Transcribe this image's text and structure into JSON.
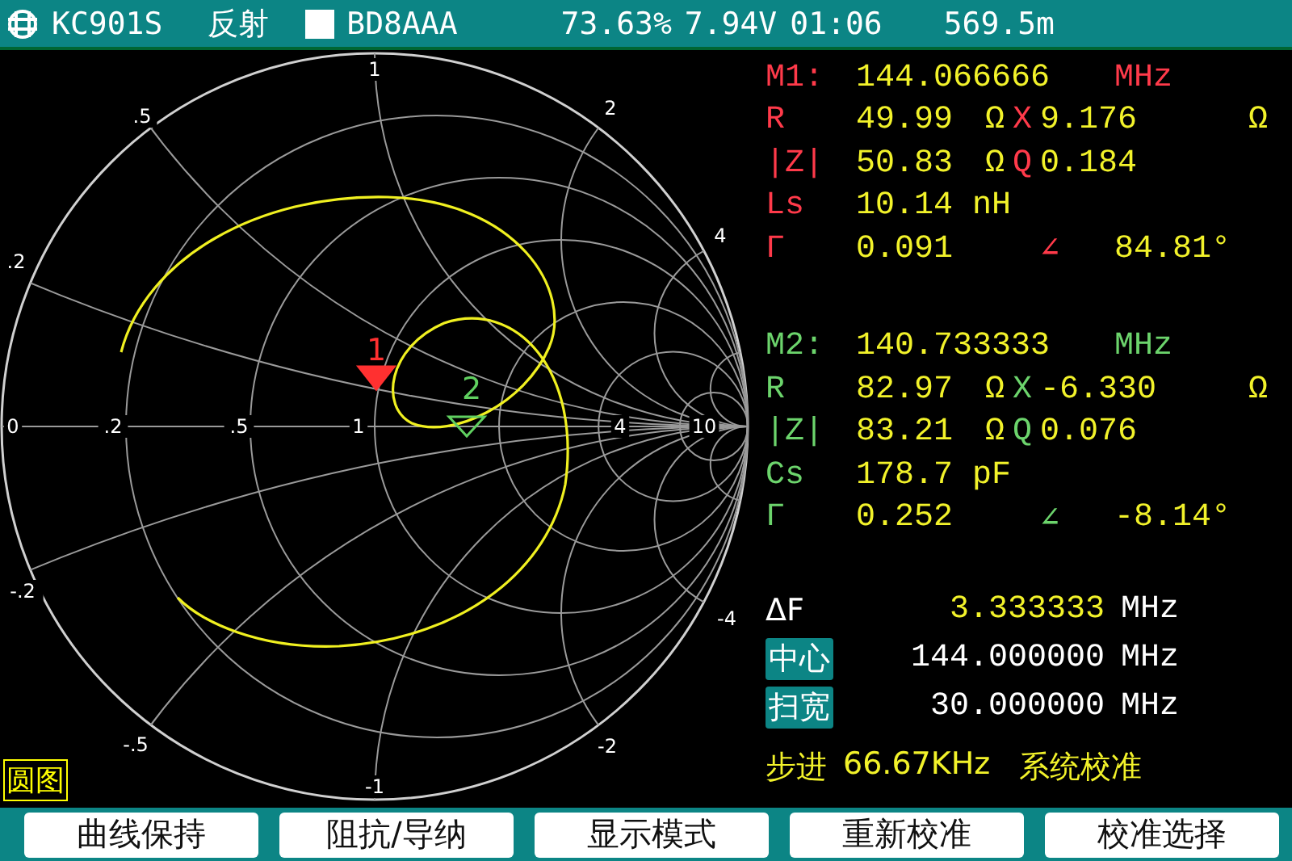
{
  "status_bar": {
    "model": "KC901S",
    "mode": "反射",
    "callsign": "BD8AAA",
    "battery": "73.63%",
    "voltage": "7.94V",
    "time": "01:06",
    "distance": "569.5m"
  },
  "smith_chart": {
    "resistance_labels": [
      "0",
      ".2",
      ".5",
      "1",
      "4",
      "10"
    ],
    "reactance_upper_labels": [
      ".2",
      ".5",
      "1",
      "2",
      "4"
    ],
    "reactance_lower_labels": [
      "-.2",
      "-.5",
      "-1",
      "-2",
      "-4"
    ],
    "markers": [
      {
        "label": "1",
        "color": "#ff3030",
        "filled": true
      },
      {
        "label": "2",
        "color": "#60d060",
        "filled": false
      }
    ],
    "view_label": "圆图"
  },
  "readouts": [
    {
      "title": "M1:",
      "color": "#ff3a4a",
      "freq": "144.066666",
      "unit": "MHz",
      "rows": [
        {
          "kind": "pair",
          "cells": [
            "R",
            "49.99",
            "Ω",
            "X",
            "9.176",
            "Ω"
          ]
        },
        {
          "kind": "pair",
          "cells": [
            "|Z|",
            "50.83",
            "Ω",
            "Q",
            "0.184"
          ]
        },
        {
          "kind": "single",
          "cells": [
            "Ls",
            "10.14 nH"
          ]
        },
        {
          "kind": "polar",
          "cells": [
            "Γ",
            "0.091",
            "",
            "",
            "∠",
            "84.81°"
          ]
        }
      ]
    },
    {
      "title": "M2:",
      "color": "#6cd46c",
      "freq": "140.733333",
      "unit": "MHz",
      "rows": [
        {
          "kind": "pair",
          "cells": [
            "R",
            "82.97",
            "Ω",
            "X",
            "-6.330",
            "Ω"
          ]
        },
        {
          "kind": "pair",
          "cells": [
            "|Z|",
            "83.21",
            "Ω",
            "Q",
            "0.076"
          ]
        },
        {
          "kind": "single",
          "cells": [
            "Cs",
            "178.7 pF"
          ]
        },
        {
          "kind": "polar",
          "cells": [
            "Γ",
            "0.252",
            "",
            "",
            "∠",
            "-8.14°"
          ]
        }
      ]
    }
  ],
  "sweep": [
    {
      "kind": "delta",
      "label": "ΔF",
      "value": "3.333333",
      "unit": "MHz"
    },
    {
      "kind": "param",
      "label": "中心",
      "value": "144.000000",
      "unit": "MHz"
    },
    {
      "kind": "param",
      "label": "扫宽",
      "value": "30.000000",
      "unit": "MHz"
    }
  ],
  "step": {
    "label": "步进",
    "value": "66.67KHz",
    "status": "系统校准"
  },
  "buttons": [
    "曲线保持",
    "阻抗/导纳",
    "显示模式",
    "重新校准",
    "校准选择"
  ]
}
